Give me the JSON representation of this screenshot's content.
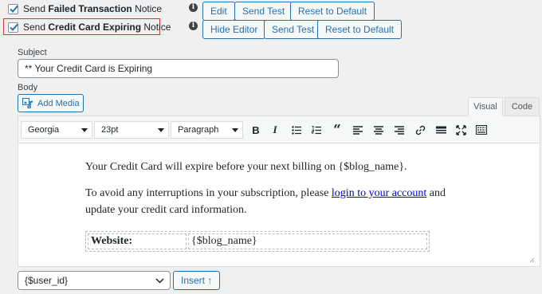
{
  "notices": [
    {
      "checked": true,
      "prefix": "Send ",
      "bold": "Failed Transaction",
      "suffix": " Notice",
      "info": "i",
      "buttons": [
        "Edit",
        "Send Test",
        "Reset to Default"
      ]
    },
    {
      "checked": true,
      "prefix": "Send ",
      "bold": "Credit Card Expiring",
      "suffix": " Notice",
      "info": "i",
      "buttons": [
        "Hide Editor",
        "Send Test",
        "Reset to Default"
      ]
    }
  ],
  "subject": {
    "label": "Subject",
    "value": "** Your Credit Card is Expiring"
  },
  "body": {
    "label": "Body",
    "add_media": "Add Media",
    "tabs": [
      "Visual",
      "Code"
    ],
    "active_tab": "Visual"
  },
  "toolbar": {
    "font_family": "Georgia",
    "font_size": "23pt",
    "format": "Paragraph",
    "buttons": [
      "bold-icon",
      "italic-icon",
      "bullet-list-icon",
      "numbered-list-icon",
      "blockquote-icon",
      "align-left-icon",
      "align-center-icon",
      "align-right-icon",
      "link-icon",
      "horizontal-rule-icon",
      "fullscreen-icon",
      "toolbar-toggle-icon"
    ]
  },
  "content": {
    "p1": "Your Credit Card will expire before your next billing on {$blog_name}.",
    "p2_before": "To avoid any interruptions in your subscription, please ",
    "p2_link": "login to your account",
    "p2_after": " and",
    "p3": "update your credit card information.",
    "table": [
      {
        "label": "Website:",
        "value": "{$blog_name}"
      }
    ]
  },
  "footer": {
    "variable_select": "{$user_id}",
    "insert_label": "Insert ↑"
  },
  "colors": {
    "accent": "#2271b1",
    "highlight_border": "#d63638",
    "link": "#0000ee"
  }
}
